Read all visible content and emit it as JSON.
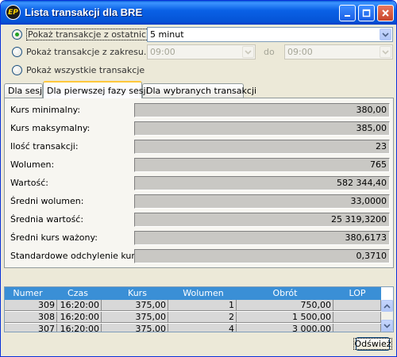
{
  "window": {
    "title": "Lista transakcji dla BRE",
    "icon_text": "EP"
  },
  "options": {
    "recent_label": "Pokaż transakcje z ostatnich",
    "recent_value": "5 minut",
    "range_label": "Pokaż transakcje z zakresu...",
    "range_from": "09:00",
    "range_to_label": "do",
    "range_to": "09:00",
    "all_label": "Pokaż wszystkie transakcje"
  },
  "tabs": [
    {
      "label": "Dla sesji"
    },
    {
      "label": "Dla pierwszej fazy sesji"
    },
    {
      "label": "Dla wybranych transakcji"
    }
  ],
  "stats": [
    {
      "label": "Kurs minimalny:",
      "value": "380,00"
    },
    {
      "label": "Kurs maksymalny:",
      "value": "385,00"
    },
    {
      "label": "Ilość transakcji:",
      "value": "23"
    },
    {
      "label": "Wolumen:",
      "value": "765"
    },
    {
      "label": "Wartość:",
      "value": "582 344,40"
    },
    {
      "label": "Średni wolumen:",
      "value": "33,0000"
    },
    {
      "label": "Średnia wartość:",
      "value": "25 319,3200"
    },
    {
      "label": "Średni kurs ważony:",
      "value": "380,6173"
    },
    {
      "label": "Standardowe odchylenie kursu:",
      "value": "0,3710"
    }
  ],
  "grid": {
    "columns": [
      "Numer",
      "Czas",
      "Kurs",
      "Wolumen",
      "Obrót",
      "LOP"
    ],
    "rows": [
      {
        "numer": "309",
        "czas": "16:20:00",
        "kurs": "375,00",
        "wolumen": "1",
        "obrot": "750,00",
        "lop": ""
      },
      {
        "numer": "308",
        "czas": "16:20:00",
        "kurs": "375,00",
        "wolumen": "2",
        "obrot": "1 500,00",
        "lop": ""
      },
      {
        "numer": "307",
        "czas": "16:20:00",
        "kurs": "375,00",
        "wolumen": "4",
        "obrot": "3 000,00",
        "lop": ""
      }
    ]
  },
  "buttons": {
    "refresh_label": "Odśwież"
  },
  "colors": {
    "title_bar": "#0553d6",
    "grid_header": "#3a8fd6",
    "active_tab_accent": "#ffc83c"
  }
}
